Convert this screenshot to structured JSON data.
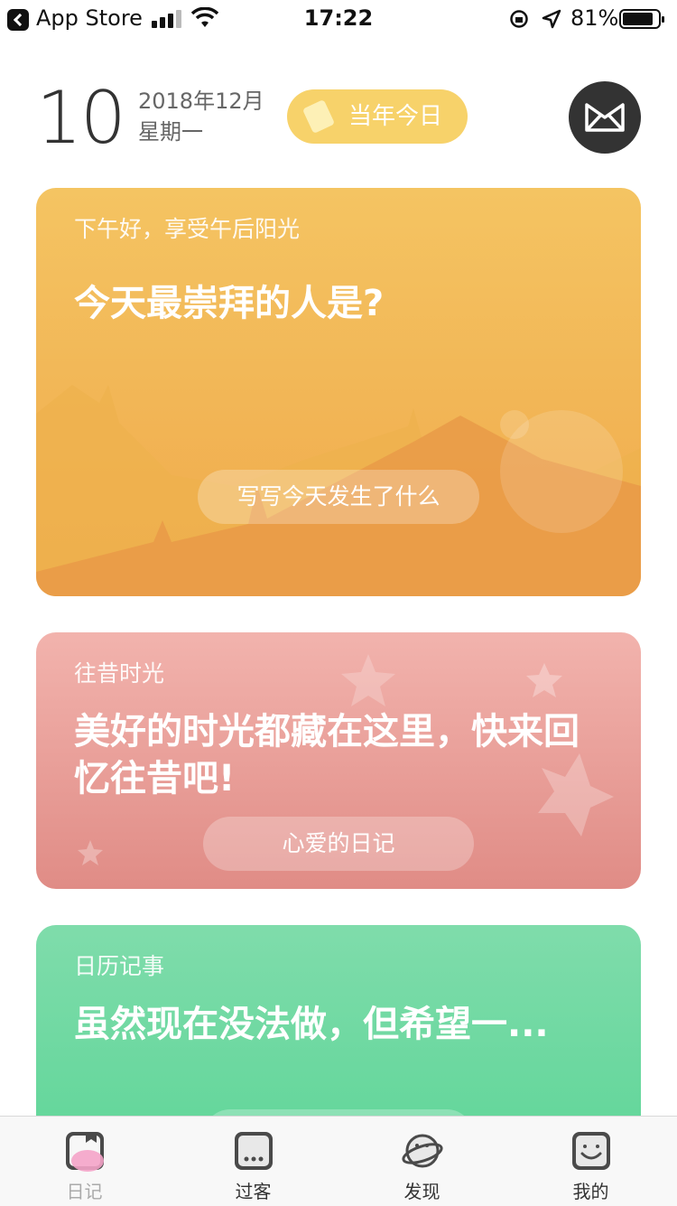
{
  "status_bar": {
    "back_app": "App Store",
    "time": "17:22",
    "battery": "81%"
  },
  "header": {
    "day": "10",
    "year_month": "2018年12月",
    "weekday": "星期一",
    "today_in_history": "当年今日",
    "action_icon": "envelope-icon"
  },
  "cards": [
    {
      "kicker": "下午好，享受午后阳光",
      "headline": "今天最崇拜的人是?",
      "cta": "写写今天发生了什么",
      "color": "#f0a94b"
    },
    {
      "kicker": "往昔时光",
      "headline": "美好的时光都藏在这里，快来回忆往昔吧!",
      "cta": "心爱的日记",
      "color": "#e08c86"
    },
    {
      "kicker": "日历记事",
      "headline": "虽然现在没法做，但希望一...",
      "color": "#62d69a"
    }
  ],
  "tabs": [
    {
      "label": "日记",
      "icon": "diary-icon",
      "active": true
    },
    {
      "label": "过客",
      "icon": "chat-icon",
      "active": false
    },
    {
      "label": "发现",
      "icon": "planet-icon",
      "active": false
    },
    {
      "label": "我的",
      "icon": "smile-face-icon",
      "active": false
    }
  ],
  "colors": {
    "accent_yellow": "#f7d26a",
    "dark_button": "#333333",
    "active_tab_pink": "#f4a3c8"
  }
}
